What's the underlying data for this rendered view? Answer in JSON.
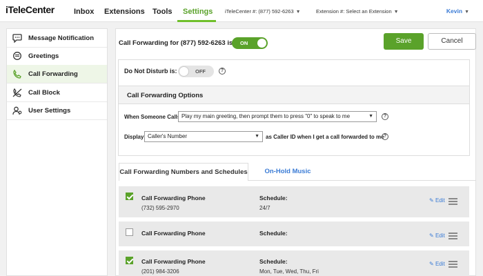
{
  "topnav": {
    "logo": "iTeleCenter",
    "items": [
      "Inbox",
      "Extensions",
      "Tools",
      "Settings"
    ],
    "active": "Settings",
    "phone_label": "iTeleCenter #: (877) 592-6263",
    "extension_label": "Extension #: Select an Extension",
    "user": "Kevin"
  },
  "sidebar": {
    "items": [
      {
        "label": "Message Notification",
        "icon": "speech-bubble-icon"
      },
      {
        "label": "Greetings",
        "icon": "greeting-bubble-icon"
      },
      {
        "label": "Call Forwarding",
        "icon": "phone-icon"
      },
      {
        "label": "Call Block",
        "icon": "blocked-phone-icon"
      },
      {
        "label": "User Settings",
        "icon": "user-settings-icon"
      }
    ],
    "active_index": 2
  },
  "header": {
    "title": "Call Forwarding for (877) 592-6263 is:",
    "status_toggle": "ON",
    "save_label": "Save",
    "cancel_label": "Cancel"
  },
  "dnd": {
    "label": "Do Not Disturb is:",
    "toggle": "OFF"
  },
  "options": {
    "header": "Call Forwarding Options",
    "when_label": "When Someone Calls",
    "when_value": "Play my main greeting, then prompt them to press \"0\" to speak to me",
    "display_label": "Display",
    "display_value": "Caller's Number",
    "display_after": "as Caller ID when I get a call forwarded to me"
  },
  "tabs": [
    {
      "label": "Call Forwarding Numbers and Schedules"
    },
    {
      "label": "On-Hold Music"
    }
  ],
  "schedules": [
    {
      "checked": true,
      "title": "Call Forwarding Phone",
      "phone": "(732) 595-2970",
      "schedule_label": "Schedule:",
      "schedule": "24/7",
      "edit": "Edit"
    },
    {
      "checked": false,
      "title": "Call Forwarding Phone",
      "phone": "",
      "schedule_label": "Schedule:",
      "schedule": "",
      "edit": "Edit"
    },
    {
      "checked": true,
      "title": "Call Forwarding Phone",
      "phone": "(201) 984-3206",
      "schedule_label": "Schedule:",
      "schedule": "Mon, Tue, Wed, Thu, Fri",
      "edit": "Edit"
    }
  ],
  "colors": {
    "accent": "#5aa22a",
    "link": "#3a7bd5"
  }
}
